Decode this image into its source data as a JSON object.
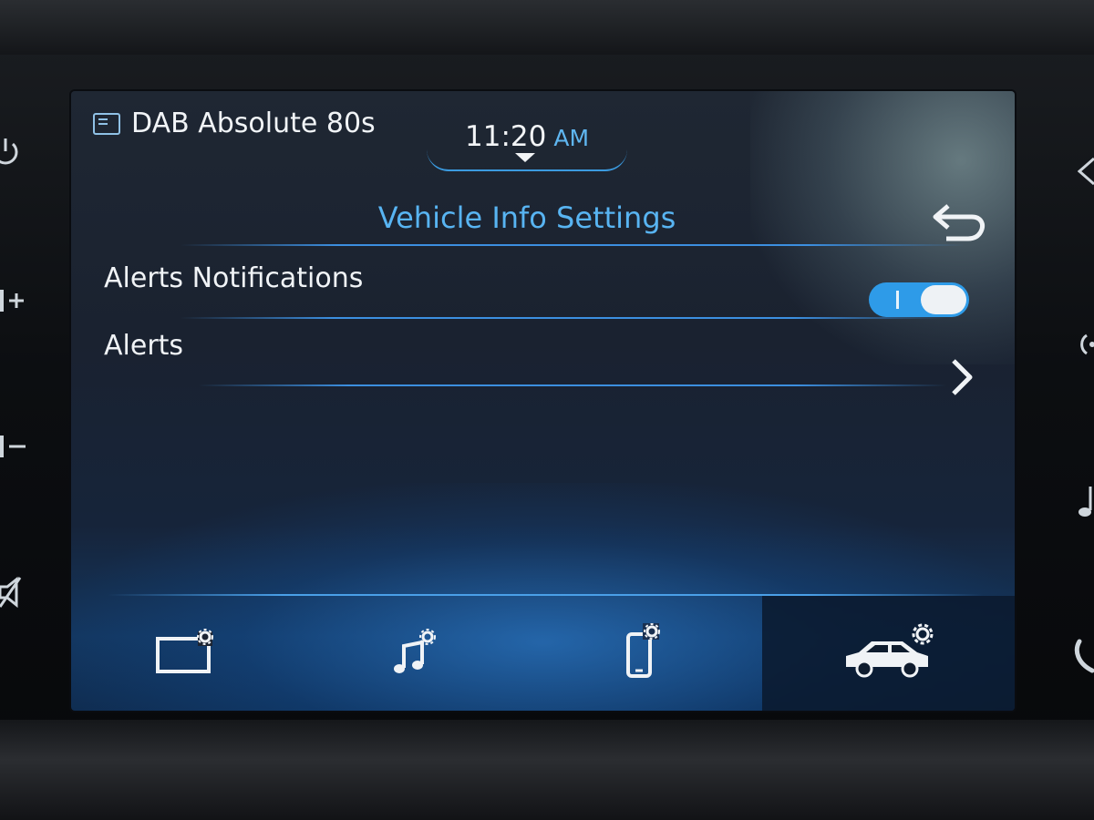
{
  "status_bar": {
    "source_label": "DAB Absolute 80s",
    "time": "11:20",
    "ampm": "AM"
  },
  "page": {
    "title": "Vehicle Info Settings"
  },
  "settings": [
    {
      "label": "Alerts Notifications",
      "control": "toggle",
      "enabled": true
    },
    {
      "label": "Alerts",
      "control": "chevron"
    }
  ],
  "bottom_tabs": [
    {
      "name": "display-settings",
      "icon": "display-gear-icon",
      "active": false
    },
    {
      "name": "sound-settings",
      "icon": "music-gear-icon",
      "active": false
    },
    {
      "name": "phone-settings",
      "icon": "phone-gear-icon",
      "active": false
    },
    {
      "name": "vehicle-settings",
      "icon": "car-gear-icon",
      "active": true
    }
  ],
  "side_buttons_left": [
    "power-icon",
    "volume-up-icon",
    "volume-down-icon",
    "mute-icon"
  ],
  "side_buttons_right": [
    "home-icon",
    "radio-icon",
    "media-icon",
    "phone-icon"
  ],
  "colors": {
    "accent": "#3c8fe0",
    "title": "#58b4f2",
    "toggle_on": "#2e9be8"
  }
}
